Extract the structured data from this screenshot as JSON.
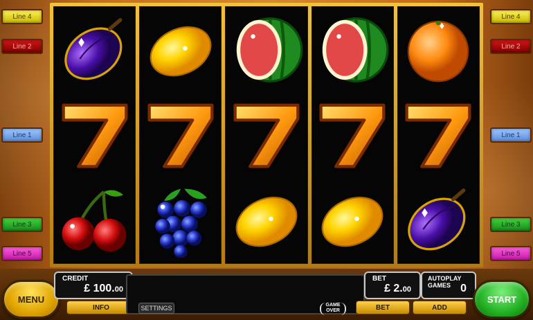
{
  "lines_left": [
    {
      "label": "Line 4",
      "color": "yellow"
    },
    {
      "label": "Line 2",
      "color": "red"
    },
    {
      "label": "Line 1",
      "color": "blue"
    },
    {
      "label": "Line 3",
      "color": "green"
    },
    {
      "label": "Line 5",
      "color": "pink"
    }
  ],
  "lines_right": [
    {
      "label": "Line 4",
      "color": "yellow"
    },
    {
      "label": "Line 2",
      "color": "red"
    },
    {
      "label": "Line 1",
      "color": "blue"
    },
    {
      "label": "Line 3",
      "color": "green"
    },
    {
      "label": "Line 5",
      "color": "pink"
    }
  ],
  "reels": [
    [
      "plum",
      "seven",
      "cherries"
    ],
    [
      "lemon",
      "seven",
      "grapes"
    ],
    [
      "watermelon",
      "seven",
      "lemon"
    ],
    [
      "watermelon",
      "seven",
      "lemon"
    ],
    [
      "orange",
      "seven",
      "plum"
    ]
  ],
  "controls": {
    "menu_label": "MENU",
    "start_label": "START",
    "credit_label": "CREDIT",
    "credit_value": "£ 100.",
    "credit_cents": "00",
    "info_label": "INFO",
    "settings_label": "SETTINGS",
    "game_over_line1": "GAME",
    "game_over_line2": "OVER",
    "bet_label": "BET",
    "bet_value": "£ 2.",
    "bet_cents": "00",
    "bet_button": "BET",
    "autoplay_label": "AUTOPLAY GAMES",
    "autoplay_value": "0",
    "add_label": "ADD"
  }
}
